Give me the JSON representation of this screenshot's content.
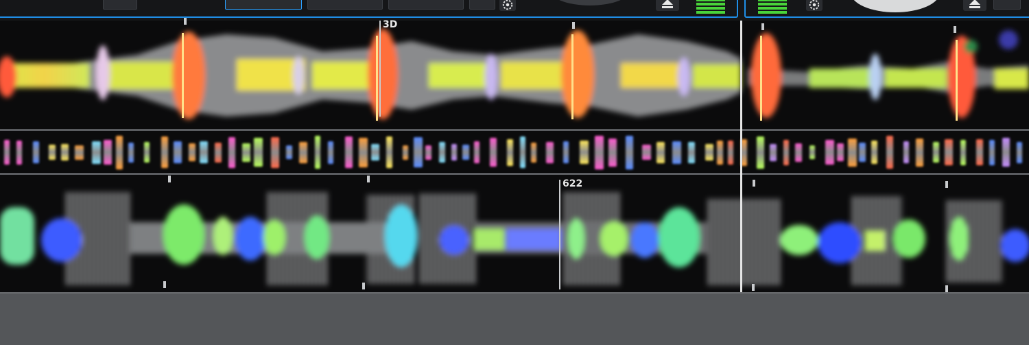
{
  "deck_a": {
    "bar_number": "3D",
    "mini_spike_colors": [
      "#7fe0ff",
      "#ff9f3a",
      "#b7ff5a",
      "#ff5ad0",
      "#5a8cff",
      "#ffe85a",
      "#c48bff",
      "#ff6a4a"
    ]
  },
  "deck_b": {
    "bar_number": "622"
  },
  "colors": {
    "accent": "#1f8fe8",
    "meter": "#49d43a",
    "background": "#0b0b0c",
    "panel": "#545659"
  },
  "icons": [
    "fx-icon",
    "eject-icon",
    "level-meter"
  ]
}
